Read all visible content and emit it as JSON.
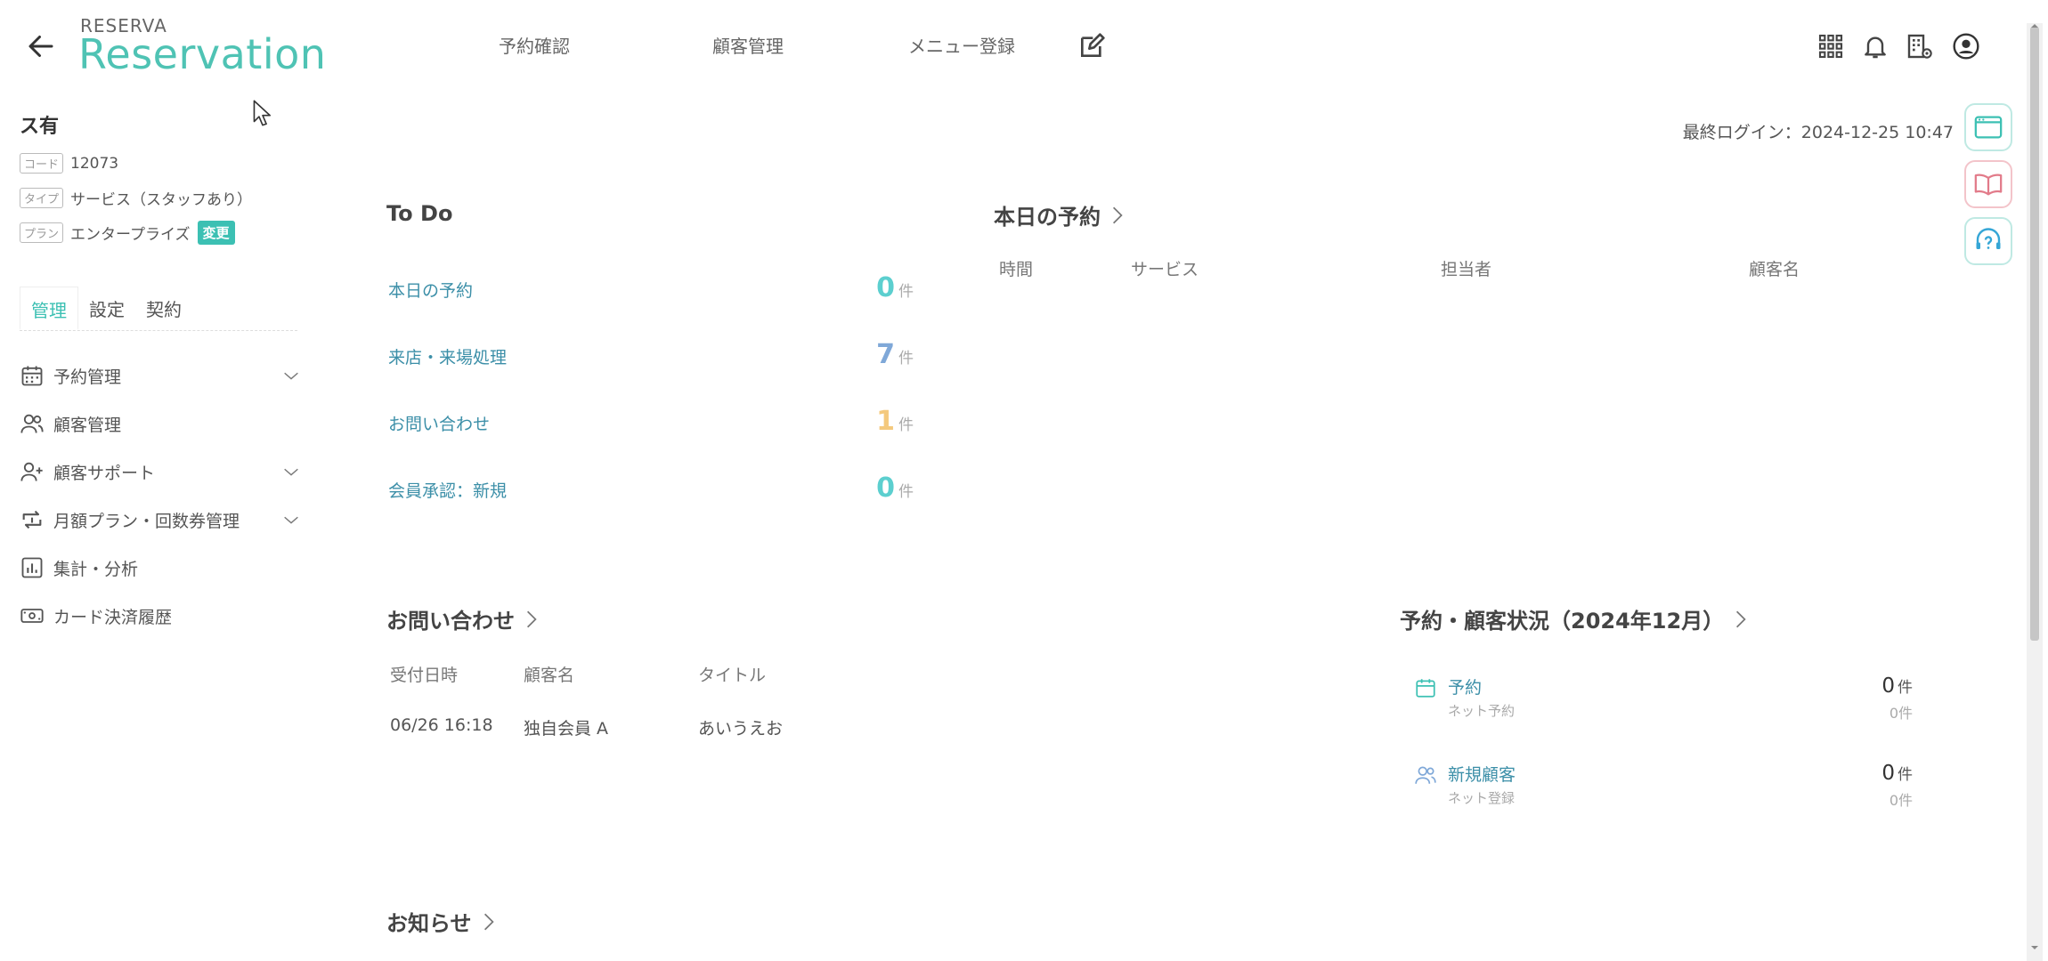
{
  "header": {
    "logo_small": "RESERVA",
    "logo_big": "Reservation",
    "nav": [
      "予約確認",
      "顧客管理",
      "メニュー登録"
    ]
  },
  "sidebar": {
    "store_name": "ス有",
    "meta": [
      {
        "tag": "コード",
        "value": "12073"
      },
      {
        "tag": "タイプ",
        "value": "サービス（スタッフあり）"
      },
      {
        "tag": "プラン",
        "value": "エンタープライズ",
        "badge": "変更"
      }
    ],
    "tabs": [
      "管理",
      "設定",
      "契約"
    ],
    "menu": [
      {
        "label": "予約管理",
        "icon": "calendar-icon"
      },
      {
        "label": "顧客管理",
        "icon": "users-icon"
      },
      {
        "label": "顧客サポート",
        "icon": "user-plus-icon"
      },
      {
        "label": "月額プラン・回数券管理",
        "icon": "repeat-icon"
      },
      {
        "label": "集計・分析",
        "icon": "bar-chart-icon"
      },
      {
        "label": "カード決済履歴",
        "icon": "card-icon"
      }
    ]
  },
  "main": {
    "last_login": "最終ログイン：2024-12-25 10:47",
    "todo": {
      "title": "To Do",
      "unit": "件",
      "items": [
        {
          "label": "本日の予約",
          "count": "0",
          "color": "#5ccfcf"
        },
        {
          "label": "来店・来場処理",
          "count": "7",
          "color": "#7fa8d8"
        },
        {
          "label": "お問い合わせ",
          "count": "1",
          "color": "#f4c97d"
        },
        {
          "label": "会員承認：新規",
          "count": "0",
          "color": "#5ccfcf"
        }
      ]
    },
    "today": {
      "title": "本日の予約",
      "headers": [
        "時間",
        "サービス",
        "担当者",
        "顧客名"
      ]
    },
    "inquiry": {
      "title": "お問い合わせ",
      "headers": [
        "受付日時",
        "顧客名",
        "タイトル"
      ],
      "rows": [
        [
          "06/26 16:18",
          "独自会員 A",
          "あいうえお"
        ]
      ]
    },
    "status": {
      "title": "予約・顧客状況（2024年12月）",
      "unit": "件",
      "items": [
        {
          "label": "予約",
          "sub": "ネット予約",
          "count": "0",
          "subcount": "0件"
        },
        {
          "label": "新規顧客",
          "sub": "ネット登録",
          "count": "0",
          "subcount": "0件"
        }
      ]
    },
    "news": {
      "title": "お知らせ"
    }
  },
  "colors": {
    "accent": "#3cc0b3",
    "link": "#3c8fa8"
  }
}
